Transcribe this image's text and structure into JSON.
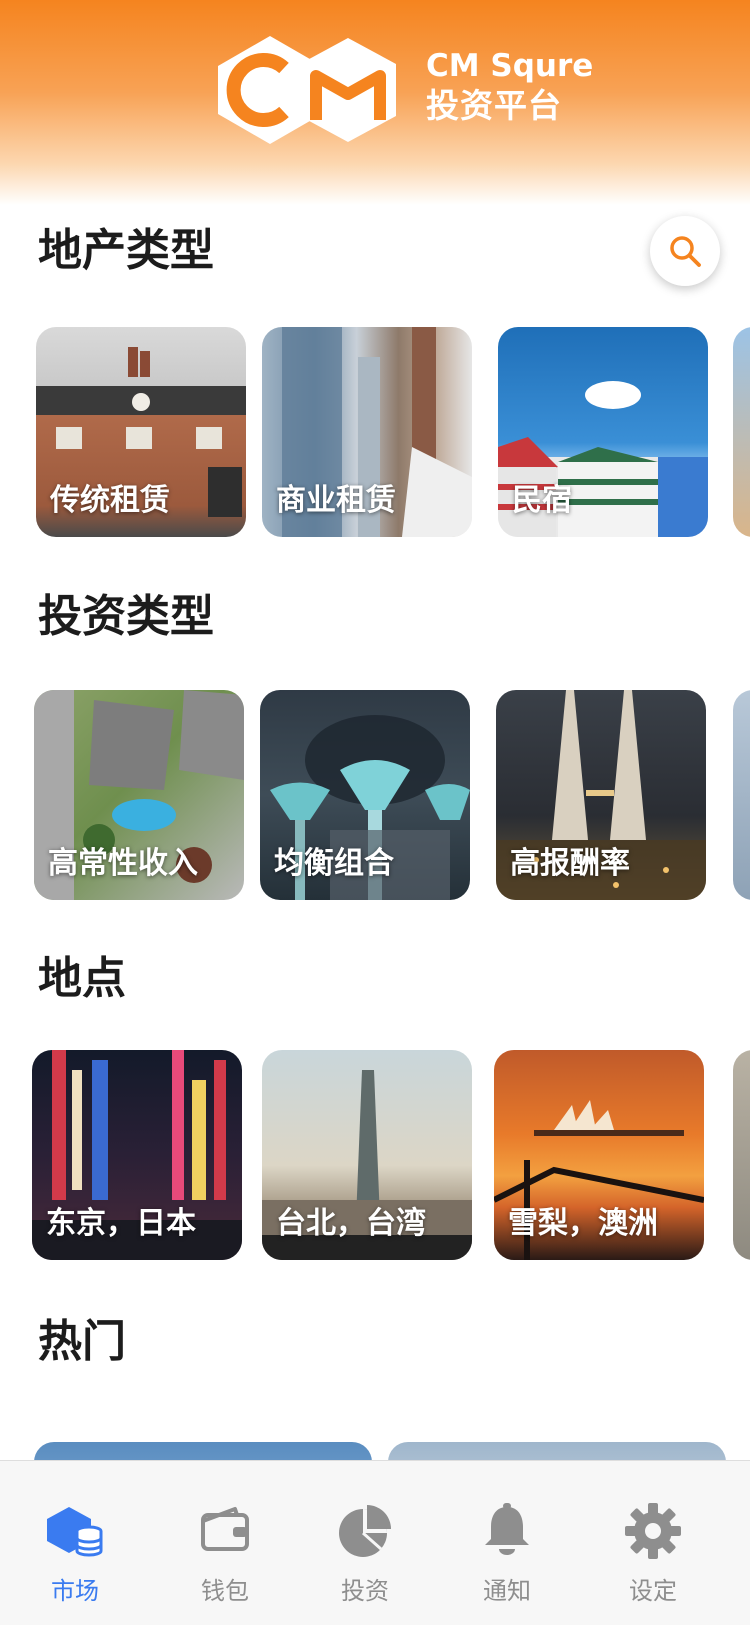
{
  "brand": {
    "title": "CM Squre",
    "subtitle": "投资平台",
    "primary": "#f5841f"
  },
  "sections": {
    "property": {
      "title": "地产类型",
      "cards": [
        {
          "label": "传统租赁",
          "image": "brick-house"
        },
        {
          "label": "商业租赁",
          "image": "skyscrapers"
        },
        {
          "label": "民宿",
          "image": "beach-huts"
        }
      ]
    },
    "investment": {
      "title": "投资类型",
      "cards": [
        {
          "label": "高常性收入",
          "image": "pool-villa-aerial"
        },
        {
          "label": "均衡组合",
          "image": "supertree-grove"
        },
        {
          "label": "高报酬率",
          "image": "twin-towers-night"
        }
      ]
    },
    "location": {
      "title": "地点",
      "cards": [
        {
          "label": "东京，日本",
          "image": "tokyo-street-night"
        },
        {
          "label": "台北，台湾",
          "image": "taipei-101"
        },
        {
          "label": "雪梨，澳洲",
          "image": "sydney-sunset"
        }
      ]
    },
    "hot": {
      "title": "热门"
    }
  },
  "search": {
    "icon": "search-icon"
  },
  "tabbar": [
    {
      "label": "市场",
      "icon": "market-icon",
      "active": true
    },
    {
      "label": "钱包",
      "icon": "wallet-icon",
      "active": false
    },
    {
      "label": "投资",
      "icon": "pie-chart-icon",
      "active": false
    },
    {
      "label": "通知",
      "icon": "bell-icon",
      "active": false
    },
    {
      "label": "设定",
      "icon": "gear-icon",
      "active": false
    }
  ],
  "colors": {
    "tab_active": "#3a7bf0",
    "tab_inactive": "#8e8e8e"
  }
}
